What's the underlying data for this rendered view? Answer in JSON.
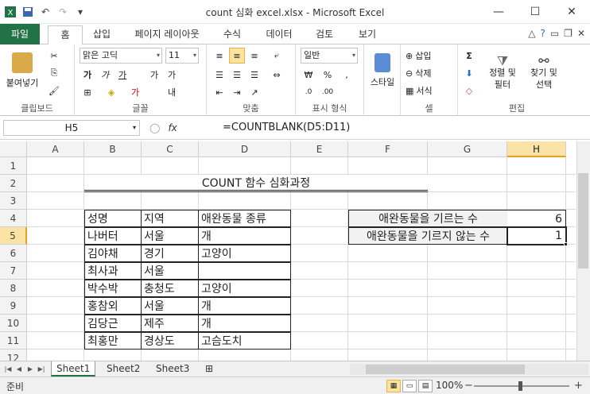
{
  "window": {
    "title": "count 심화 excel.xlsx  -  Microsoft Excel"
  },
  "ribbon_tabs": [
    "파일",
    "홈",
    "삽입",
    "페이지 레이아웃",
    "수식",
    "데이터",
    "검토",
    "보기"
  ],
  "ribbon": {
    "clipboard": {
      "paste": "붙여넣기",
      "label": "클립보드"
    },
    "font": {
      "name": "맑은 고딕",
      "size": "11",
      "label": "글꼴"
    },
    "alignment": {
      "label": "맞춤"
    },
    "number": {
      "format": "일반",
      "label": "표시 형식"
    },
    "styles": {
      "style": "스타일"
    },
    "cells": {
      "insert": "삽입",
      "delete": "삭제",
      "format": "서식",
      "label": "셀"
    },
    "editing": {
      "sort": "정렬 및",
      "sort2": "필터",
      "find": "찾기 및",
      "find2": "선택",
      "label": "편집"
    }
  },
  "formula_bar": {
    "name_box": "H5",
    "formula": "=COUNTBLANK(D5:D11)"
  },
  "columns": [
    "A",
    "B",
    "C",
    "D",
    "E",
    "F",
    "G",
    "H"
  ],
  "rows": [
    "1",
    "2",
    "3",
    "4",
    "5",
    "6",
    "7",
    "8",
    "9",
    "10",
    "11",
    "12"
  ],
  "sheet": {
    "title": "COUNT 함수 심화과정",
    "table_headers": [
      "성명",
      "지역",
      "애완동물 종류"
    ],
    "table_rows": [
      [
        "나버터",
        "서울",
        "개"
      ],
      [
        "김야채",
        "경기",
        "고양이"
      ],
      [
        "최사과",
        "서울",
        ""
      ],
      [
        "박수박",
        "충청도",
        "고양이"
      ],
      [
        "홍참외",
        "서울",
        "개"
      ],
      [
        "김당근",
        "제주",
        "개"
      ],
      [
        "최홍만",
        "경상도",
        "고슴도치"
      ]
    ],
    "summary": [
      {
        "label": "애완동물을 기르는 수",
        "value": "6"
      },
      {
        "label": "애완동물을 기르지 않는 수",
        "value": "1"
      }
    ]
  },
  "sheet_tabs": [
    "Sheet1",
    "Sheet2",
    "Sheet3"
  ],
  "status": {
    "mode": "준비",
    "zoom": "100%"
  }
}
